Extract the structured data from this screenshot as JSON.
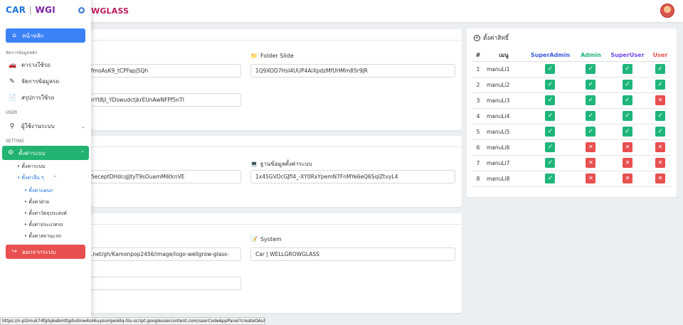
{
  "header": {
    "brand_tail": "WGLASS"
  },
  "sidebar": {
    "logo_left": "CAR",
    "logo_sep": "|",
    "logo_right": "WGI",
    "home_label": "หน้าหลัก",
    "section_manage": "จัดการข้อมูลหลัก",
    "items_manage": [
      "ตารางใช้รถ",
      "จัดการข้อมูลรถ",
      "สรุปการใช้รถ"
    ],
    "section_user": "USER",
    "user_item": "ผู้ใช้งานระบบ",
    "section_setting": "SETTING",
    "setting_label": "ตั้งค่าระบบ",
    "sub_items": [
      "ตั้งค่าระบบ",
      "ตั้งค่าอื่น ๆ"
    ],
    "subsub_items": [
      "ตั้งค่าแผนก",
      "ตั้งค่าฝ่าย",
      "ตั้งค่าวัตถุประสงค์",
      "ตั้งค่าประเภทรถ",
      "ตั้งค่าสถานะรถ"
    ],
    "logout_label": "ออกจากระบบ"
  },
  "form": {
    "folder_slide_label": "Folder Slide",
    "field1": "fmoAsK9_tCPFapj5Qh",
    "folder_slide_value": "1Q9XOD7HsI4UUP4AiXpdzMfUHMm85r9JR",
    "field2": "nYt8jI_YDswudctjkrEUnAwNFPf5nTI",
    "field3": "5eceptDHdcqJjtyT9sOuamM6tknVE",
    "db_label": "ฐานข้อมูลตั้งค่าระบบ",
    "db_value": "1x45GVDcGJfl4_-XY0RxYpemN7FnMYe6eQ6SqIZtvyL4",
    "field4": ".net/gh/Kamonpop2456/image/logo-wellgrow-glass-",
    "system_label": "System",
    "system_value": "Car | WELLGROWGLASS",
    "field5": ""
  },
  "permissions": {
    "title": "ตั้งค่าสิทธิ์",
    "headers": [
      "#",
      "เมนู",
      "SuperAdmin",
      "Admin",
      "SuperUser",
      "User"
    ],
    "header_colors": [
      "#333333",
      "#333333",
      "#3b5bdb",
      "#1fb57a",
      "#7048e8",
      "#e84f4f"
    ],
    "rows": [
      {
        "num": "1",
        "menu": "manuLi1",
        "perms": [
          true,
          true,
          true,
          true
        ]
      },
      {
        "num": "2",
        "menu": "manuLi2",
        "perms": [
          true,
          true,
          true,
          true
        ]
      },
      {
        "num": "3",
        "menu": "manuLi3",
        "perms": [
          true,
          true,
          true,
          false
        ]
      },
      {
        "num": "4",
        "menu": "manuLi4",
        "perms": [
          true,
          true,
          true,
          true
        ]
      },
      {
        "num": "5",
        "menu": "manuLi5",
        "perms": [
          true,
          true,
          true,
          true
        ]
      },
      {
        "num": "6",
        "menu": "manuLi6",
        "perms": [
          true,
          false,
          false,
          false
        ]
      },
      {
        "num": "7",
        "menu": "manuLi7",
        "perms": [
          true,
          false,
          false,
          false
        ]
      },
      {
        "num": "8",
        "menu": "manuLi8",
        "perms": [
          true,
          false,
          false,
          false
        ]
      }
    ]
  },
  "status_url": "https://n-pl2muk74fghpkebmttgdvdmw4s46uysumjeo6lq-0lu-script.googleusercontent.com/userCodeAppPanel?createOAuthDialog=true#"
}
